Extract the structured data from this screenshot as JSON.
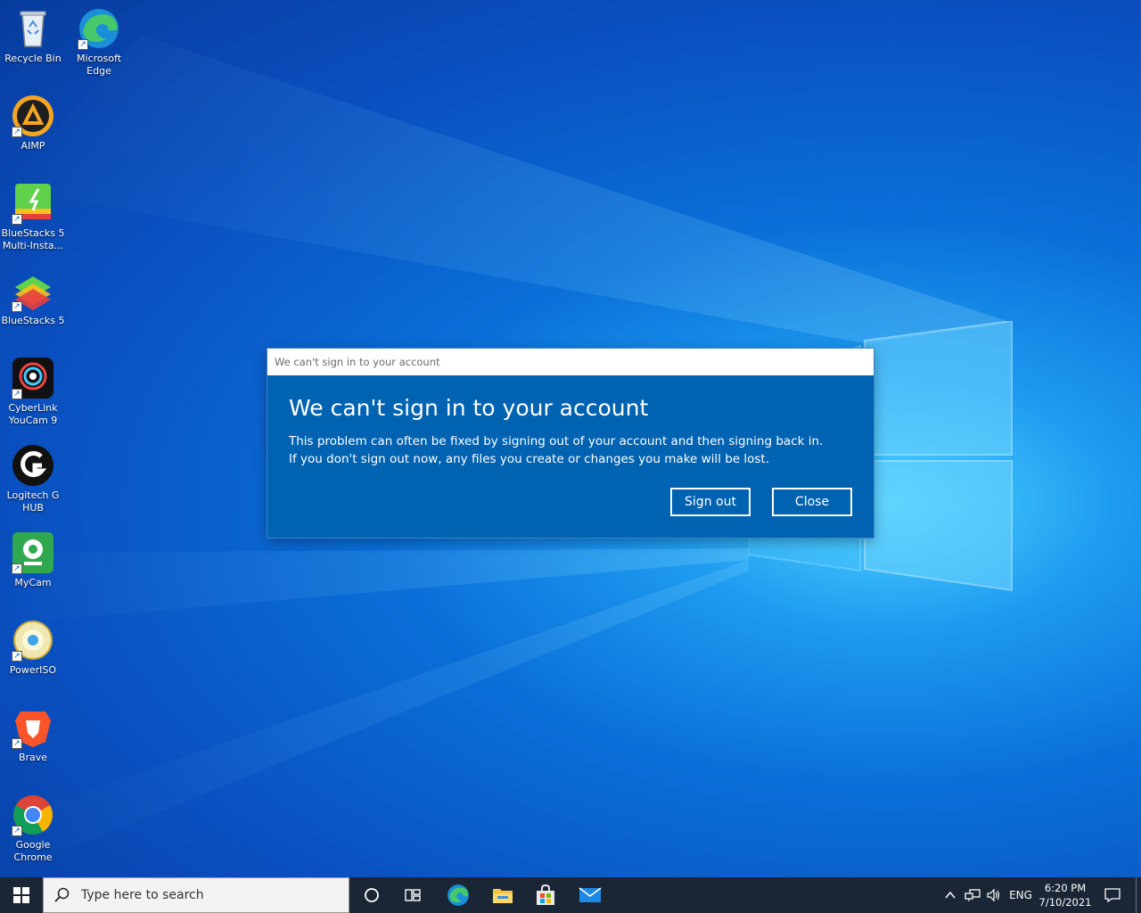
{
  "desktop": {
    "icons": [
      {
        "label": "Recycle Bin",
        "icon": "recycle-bin-icon"
      },
      {
        "label": "Microsoft Edge",
        "icon": "edge-icon"
      },
      {
        "label": "AIMP",
        "icon": "aimp-icon"
      },
      {
        "label": "BlueStacks 5 Multi-Insta...",
        "icon": "bluestacks-multi-icon"
      },
      {
        "label": "BlueStacks 5",
        "icon": "bluestacks-icon"
      },
      {
        "label": "CyberLink YouCam 9",
        "icon": "youcam-icon"
      },
      {
        "label": "Logitech G HUB",
        "icon": "logitech-icon"
      },
      {
        "label": "MyCam",
        "icon": "mycam-icon"
      },
      {
        "label": "PowerISO",
        "icon": "poweriso-icon"
      },
      {
        "label": "Brave",
        "icon": "brave-icon"
      },
      {
        "label": "Google Chrome",
        "icon": "chrome-icon"
      }
    ]
  },
  "dialog": {
    "window_title": "We can't sign in to your account",
    "heading": "We can't sign in to your account",
    "line1": "This problem can often be fixed by signing out of your account and then signing back in.",
    "line2": "If you don't sign out now, any files you create or changes you make will be lost.",
    "sign_out_label": "Sign out",
    "close_label": "Close",
    "accent": "#0063b1"
  },
  "taskbar": {
    "search_placeholder": "Type here to search",
    "language": "ENG",
    "time": "6:20 PM",
    "date": "7/10/2021",
    "bg": "#1a2535"
  }
}
